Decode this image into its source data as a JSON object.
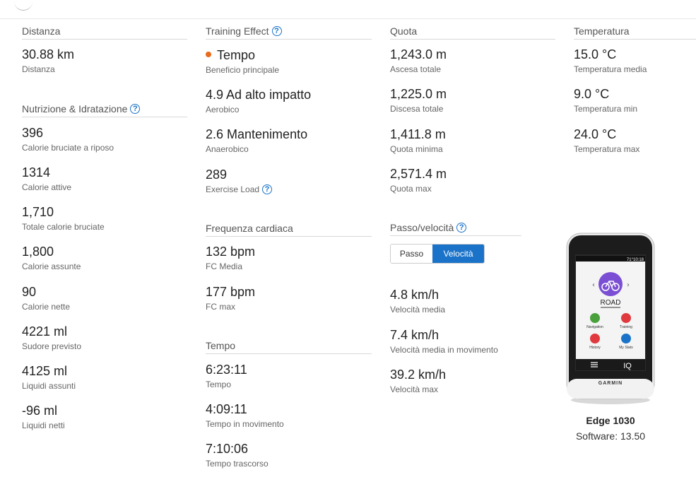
{
  "col1": {
    "distance_title": "Distanza",
    "distance": {
      "value": "30.88 km",
      "label": "Distanza"
    },
    "nutrition_title": "Nutrizione & Idratazione",
    "nutrition": [
      {
        "value": "396",
        "label": "Calorie bruciate a riposo"
      },
      {
        "value": "1314",
        "label": "Calorie attive"
      },
      {
        "value": "1,710",
        "label": "Totale calorie bruciate"
      },
      {
        "value": "1,800",
        "label": "Calorie assunte"
      },
      {
        "value": "90",
        "label": "Calorie nette"
      },
      {
        "value": "4221 ml",
        "label": "Sudore previsto"
      },
      {
        "value": "4125 ml",
        "label": "Liquidi assunti"
      },
      {
        "value": "-96 ml",
        "label": "Liquidi netti"
      }
    ]
  },
  "col2": {
    "te_title": "Training Effect",
    "te": [
      {
        "value": "Tempo",
        "label": "Beneficio principale"
      },
      {
        "value": "4.9 Ad alto impatto",
        "label": "Aerobico"
      },
      {
        "value": "2.6 Mantenimento",
        "label": "Anaerobico"
      },
      {
        "value": "289",
        "label": "Exercise Load"
      }
    ],
    "te_dot_color": "#e86a1c",
    "hr_title": "Frequenza cardiaca",
    "hr": [
      {
        "value": "132 bpm",
        "label": "FC Media"
      },
      {
        "value": "177 bpm",
        "label": "FC max"
      }
    ],
    "time_title": "Tempo",
    "time": [
      {
        "value": "6:23:11",
        "label": "Tempo"
      },
      {
        "value": "4:09:11",
        "label": "Tempo in movimento"
      },
      {
        "value": "7:10:06",
        "label": "Tempo trascorso"
      }
    ]
  },
  "col3": {
    "elev_title": "Quota",
    "elev": [
      {
        "value": "1,243.0 m",
        "label": "Ascesa totale"
      },
      {
        "value": "1,225.0 m",
        "label": "Discesa totale"
      },
      {
        "value": "1,411.8 m",
        "label": "Quota minima"
      },
      {
        "value": "2,571.4 m",
        "label": "Quota max"
      }
    ],
    "pace_title": "Passo/velocità",
    "toggle": {
      "off": "Passo",
      "on": "Velocità"
    },
    "speed": [
      {
        "value": "4.8 km/h",
        "label": "Velocità media"
      },
      {
        "value": "7.4 km/h",
        "label": "Velocità media in movimento"
      },
      {
        "value": "39.2 km/h",
        "label": "Velocità max"
      }
    ]
  },
  "col4": {
    "temp_title": "Temperatura",
    "temp": [
      {
        "value": "15.0 °C",
        "label": "Temperatura media"
      },
      {
        "value": "9.0 °C",
        "label": "Temperatura min"
      },
      {
        "value": "24.0 °C",
        "label": "Temperatura max"
      }
    ]
  },
  "device": {
    "name": "Edge 1030",
    "software": "Software: 13.50",
    "screen": {
      "time": "10:18",
      "temp": "71°",
      "profile": "ROAD",
      "tiles": [
        "Navigation",
        "Training",
        "History",
        "My Stats"
      ],
      "bottom_right": "IQ",
      "brand": "GARMIN"
    }
  },
  "colors": {
    "accent": "#1a73c9",
    "dot": "#e86a1c"
  }
}
